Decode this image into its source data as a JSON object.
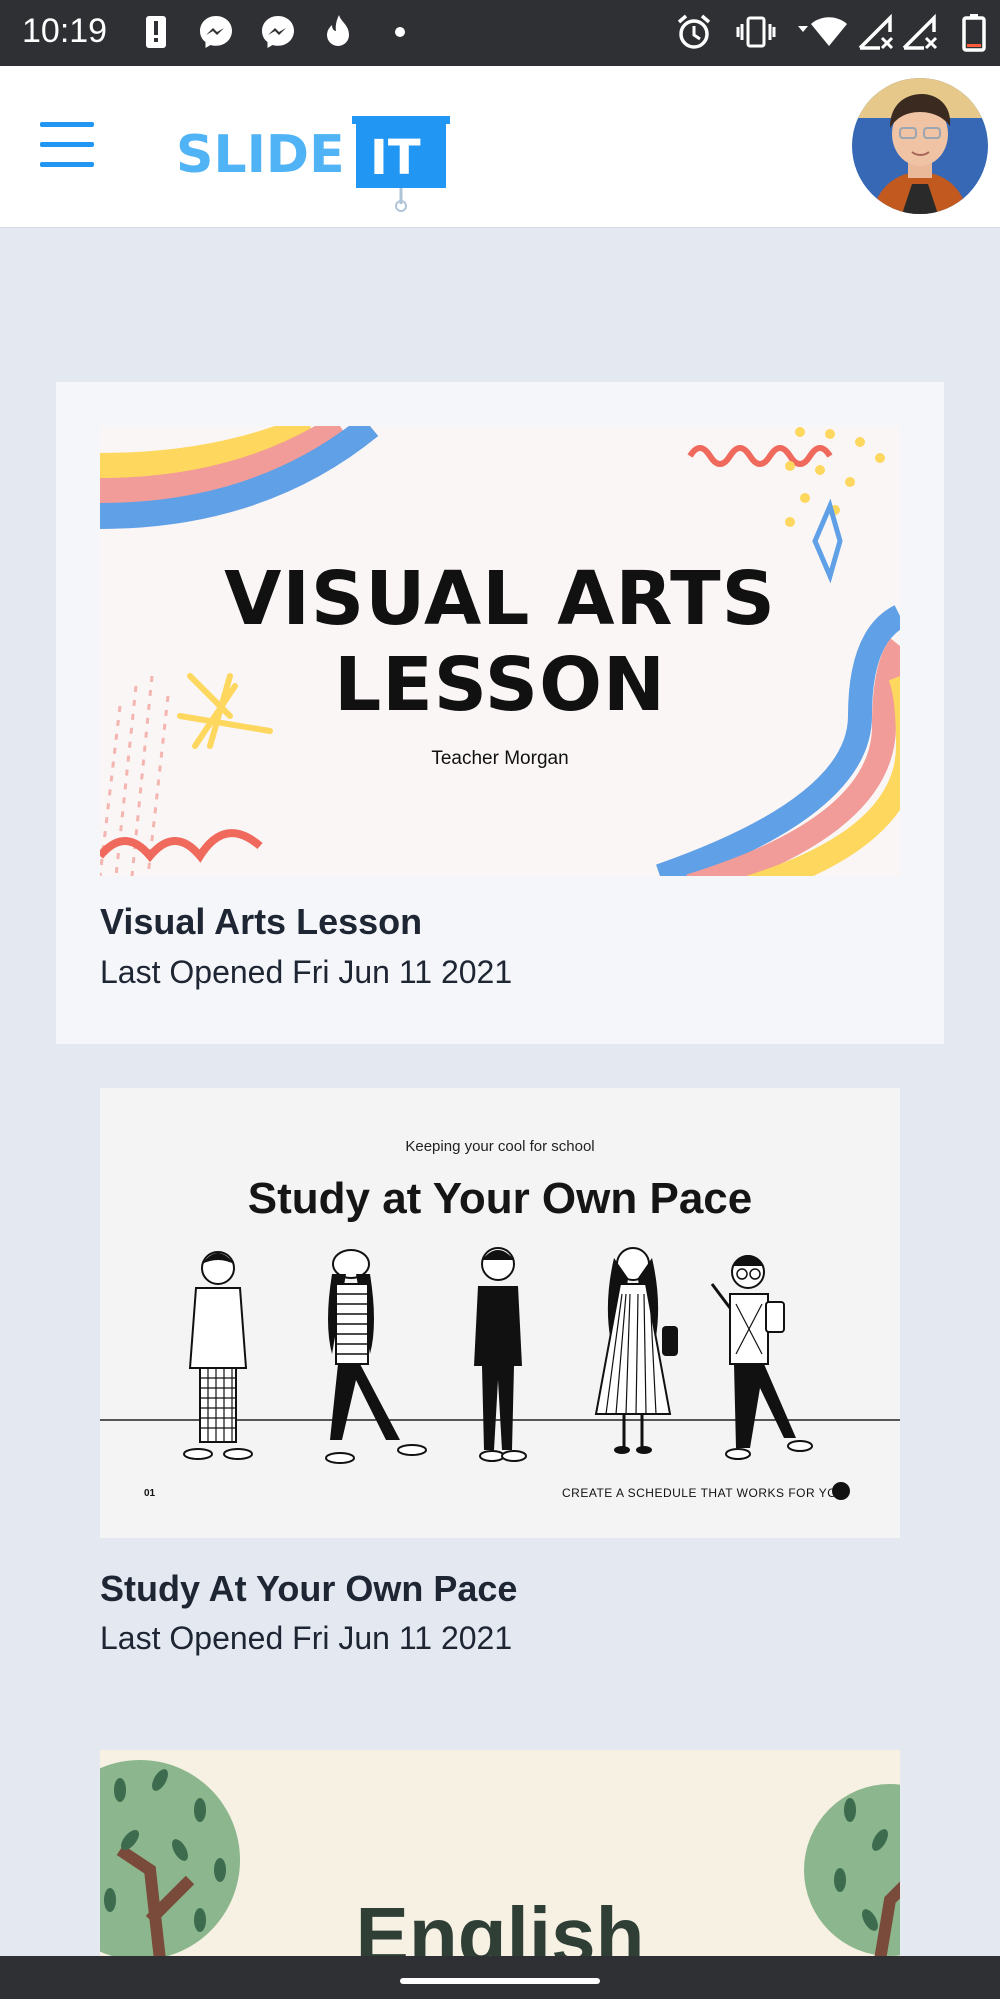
{
  "status_bar": {
    "time": "10:19",
    "icons_left": [
      "alert-icon",
      "messenger-icon",
      "messenger-icon",
      "fire-icon",
      "dot-icon"
    ],
    "icons_right": [
      "alarm-icon",
      "vibrate-icon",
      "wifi-icon",
      "no-signal-icon",
      "no-signal-icon",
      "battery-icon"
    ]
  },
  "header": {
    "logo_text_left": "SLIDE",
    "logo_text_right": "IT",
    "menu_icon": "hamburger-menu-icon",
    "avatar": "profile-avatar"
  },
  "colors": {
    "accent": "#2196f3",
    "logo_light": "#4fb3f5",
    "background": "#e3e8f1",
    "text": "#1e2533"
  },
  "presentations": [
    {
      "title": "Visual Arts Lesson",
      "subtitle": "Last Opened Fri Jun 11 2021",
      "slide_title_line1": "VISUAL ARTS",
      "slide_title_line2": "LESSON",
      "slide_subtitle": "Teacher Morgan"
    },
    {
      "title": "Study At Your Own Pace",
      "subtitle": "Last Opened Fri Jun 11 2021",
      "slide_kicker": "Keeping your cool for school",
      "slide_title": "Study at Your Own Pace",
      "slide_number": "01",
      "slide_footer": "CREATE A SCHEDULE THAT WORKS FOR YOU"
    },
    {
      "slide_title": "English"
    }
  ]
}
